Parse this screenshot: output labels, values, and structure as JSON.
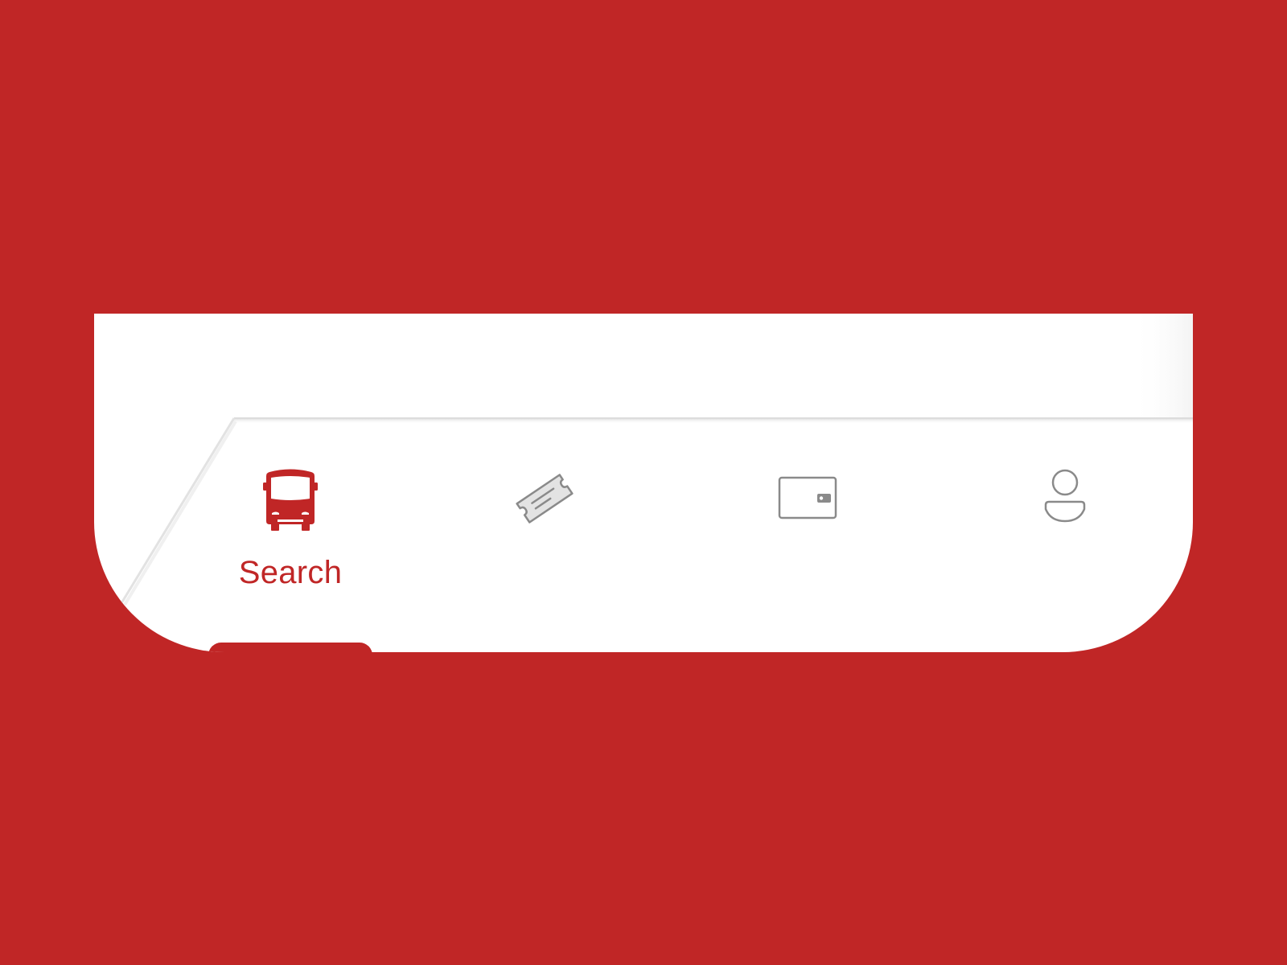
{
  "colors": {
    "background": "#c02626",
    "surface": "#ffffff",
    "active": "#c02626",
    "inactive": "#8a8a8a",
    "inactive_fill": "#e3e3e3"
  },
  "tab_bar": {
    "tabs": [
      {
        "id": "search",
        "icon": "bus-icon",
        "label": "Search",
        "active": true
      },
      {
        "id": "tickets",
        "icon": "ticket-icon",
        "label": "",
        "active": false
      },
      {
        "id": "wallet",
        "icon": "wallet-icon",
        "label": "",
        "active": false
      },
      {
        "id": "account",
        "icon": "user-icon",
        "label": "",
        "active": false
      }
    ]
  }
}
